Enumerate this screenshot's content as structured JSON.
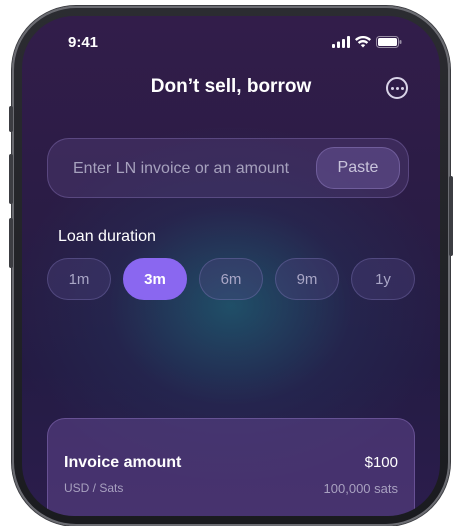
{
  "status_bar": {
    "time": "9:41"
  },
  "header": {
    "title": "Don’t sell, borrow",
    "more_icon": "ellipsis-circle-icon"
  },
  "invoice_input": {
    "placeholder": "Enter LN invoice or an amount",
    "paste_label": "Paste"
  },
  "loan_duration": {
    "label": "Loan duration",
    "options": [
      "1m",
      "3m",
      "6m",
      "9m",
      "1y"
    ],
    "selected": "3m"
  },
  "invoice_card": {
    "title": "Invoice amount",
    "amount": "$100",
    "units": "USD / Sats",
    "sats": "100,000 sats"
  },
  "colors": {
    "accent": "#8a67f0",
    "background": "#2a1c45"
  }
}
